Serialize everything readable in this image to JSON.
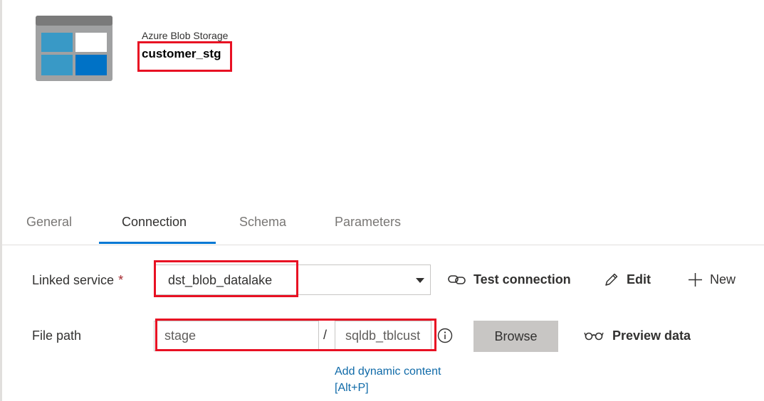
{
  "dataset": {
    "type_label": "Azure Blob Storage",
    "name": "customer_stg",
    "icon": "azure-blob-storage-icon"
  },
  "tabs": [
    {
      "label": "General",
      "active": false
    },
    {
      "label": "Connection",
      "active": true
    },
    {
      "label": "Schema",
      "active": false
    },
    {
      "label": "Parameters",
      "active": false
    }
  ],
  "connection": {
    "linked_service": {
      "label": "Linked service",
      "required_mark": "*",
      "value": "dst_blob_datalake"
    },
    "actions": {
      "test_connection": "Test connection",
      "edit": "Edit",
      "new": "New"
    },
    "file_path": {
      "label": "File path",
      "container": "stage",
      "separator": "/",
      "directory": "sqldb_tblcust",
      "browse": "Browse",
      "preview": "Preview data",
      "dynamic_line1": "Add dynamic content",
      "dynamic_line2": "[Alt+P]"
    }
  },
  "colors": {
    "accent": "#0078d4",
    "highlight": "#e81123",
    "link": "#0f6aa8"
  }
}
